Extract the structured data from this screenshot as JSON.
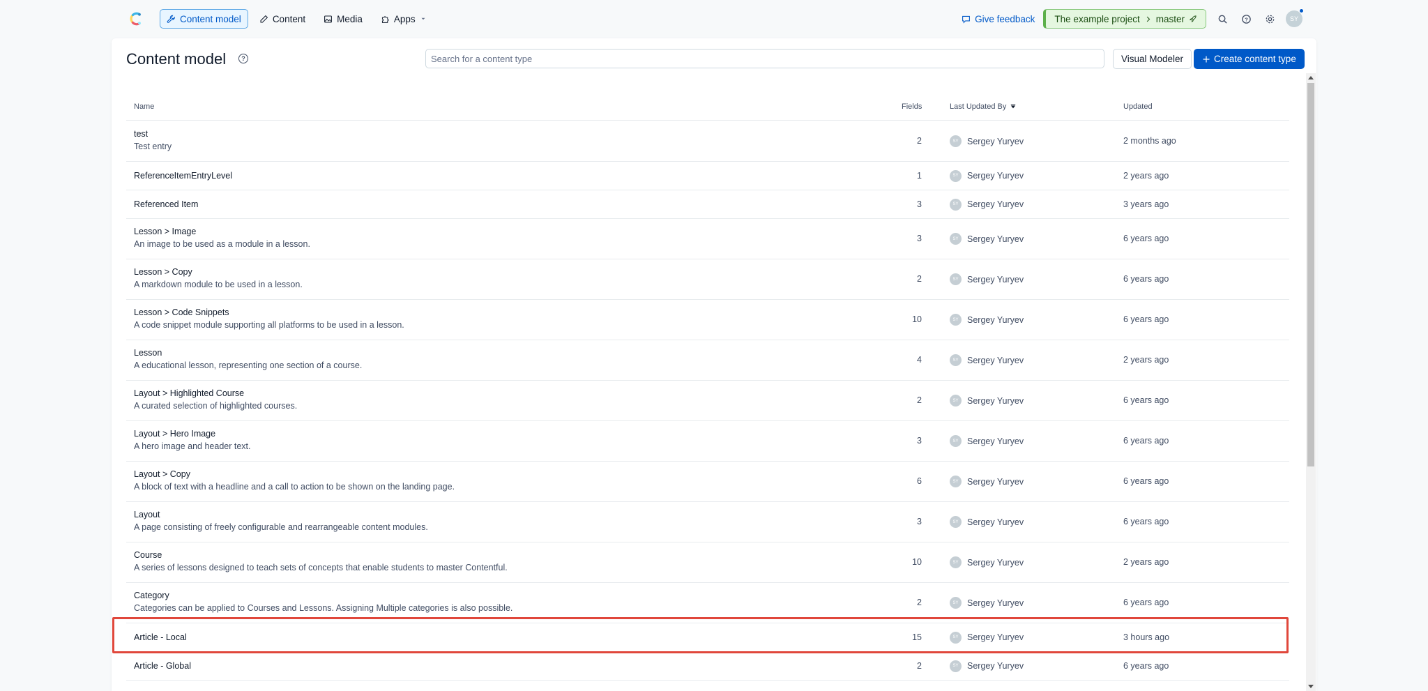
{
  "nav": {
    "items": [
      {
        "label": "Content model",
        "icon": "wrench-icon",
        "active": true
      },
      {
        "label": "Content",
        "icon": "pen-icon",
        "active": false
      },
      {
        "label": "Media",
        "icon": "image-icon",
        "active": false
      },
      {
        "label": "Apps",
        "icon": "puzzle-icon",
        "active": false
      }
    ],
    "feedback_label": "Give feedback",
    "env_project": "The example project",
    "env_separator": ">",
    "env_branch": "master",
    "avatar_initials": "SY"
  },
  "header": {
    "title": "Content model",
    "search_placeholder": "Search for a content type",
    "visual_modeler_label": "Visual Modeler",
    "create_label": "Create content type"
  },
  "table": {
    "columns": {
      "name": "Name",
      "fields": "Fields",
      "last_updated_by": "Last Updated By",
      "updated": "Updated"
    },
    "rows": [
      {
        "name": "test",
        "desc": "Test entry",
        "fields": "2",
        "user": "Sergey Yuryev",
        "initials": "SY",
        "updated": "2 months ago"
      },
      {
        "name": "ReferenceItemEntryLevel",
        "desc": "",
        "fields": "1",
        "user": "Sergey Yuryev",
        "initials": "SY",
        "updated": "2 years ago"
      },
      {
        "name": "Referenced Item",
        "desc": "",
        "fields": "3",
        "user": "Sergey Yuryev",
        "initials": "SY",
        "updated": "3 years ago"
      },
      {
        "name": "Lesson > Image",
        "desc": "An image to be used as a module in a lesson.",
        "fields": "3",
        "user": "Sergey Yuryev",
        "initials": "SY",
        "updated": "6 years ago"
      },
      {
        "name": "Lesson > Copy",
        "desc": "A markdown module to be used in a lesson.",
        "fields": "2",
        "user": "Sergey Yuryev",
        "initials": "SY",
        "updated": "6 years ago"
      },
      {
        "name": "Lesson > Code Snippets",
        "desc": "A code snippet module supporting all platforms to be used in a lesson.",
        "fields": "10",
        "user": "Sergey Yuryev",
        "initials": "SY",
        "updated": "6 years ago"
      },
      {
        "name": "Lesson",
        "desc": "A educational lesson, representing one section of a course.",
        "fields": "4",
        "user": "Sergey Yuryev",
        "initials": "SY",
        "updated": "2 years ago"
      },
      {
        "name": "Layout > Highlighted Course",
        "desc": "A curated selection of highlighted courses.",
        "fields": "2",
        "user": "Sergey Yuryev",
        "initials": "SY",
        "updated": "6 years ago"
      },
      {
        "name": "Layout > Hero Image",
        "desc": "A hero image and header text.",
        "fields": "3",
        "user": "Sergey Yuryev",
        "initials": "SY",
        "updated": "6 years ago"
      },
      {
        "name": "Layout > Copy",
        "desc": "A block of text with a headline and a call to action to be shown on the landing page.",
        "fields": "6",
        "user": "Sergey Yuryev",
        "initials": "SY",
        "updated": "6 years ago"
      },
      {
        "name": "Layout",
        "desc": "A page consisting of freely configurable and rearrangeable content modules.",
        "fields": "3",
        "user": "Sergey Yuryev",
        "initials": "SY",
        "updated": "6 years ago"
      },
      {
        "name": "Course",
        "desc": "A series of lessons designed to teach sets of concepts that enable students to master Contentful.",
        "fields": "10",
        "user": "Sergey Yuryev",
        "initials": "SY",
        "updated": "2 years ago"
      },
      {
        "name": "Category",
        "desc": "Categories can be applied to Courses and Lessons. Assigning Multiple categories is also possible.",
        "fields": "2",
        "user": "Sergey Yuryev",
        "initials": "SY",
        "updated": "6 years ago"
      },
      {
        "name": "Article - Local",
        "desc": "",
        "fields": "15",
        "user": "Sergey Yuryev",
        "initials": "SY",
        "updated": "3 hours ago"
      },
      {
        "name": "Article - Global",
        "desc": "",
        "fields": "2",
        "user": "Sergey Yuryev",
        "initials": "SY",
        "updated": "6 years ago"
      }
    ]
  },
  "colors": {
    "accent": "#0059c8",
    "highlight": "#e0473b",
    "env_green": "#5cb04a"
  }
}
